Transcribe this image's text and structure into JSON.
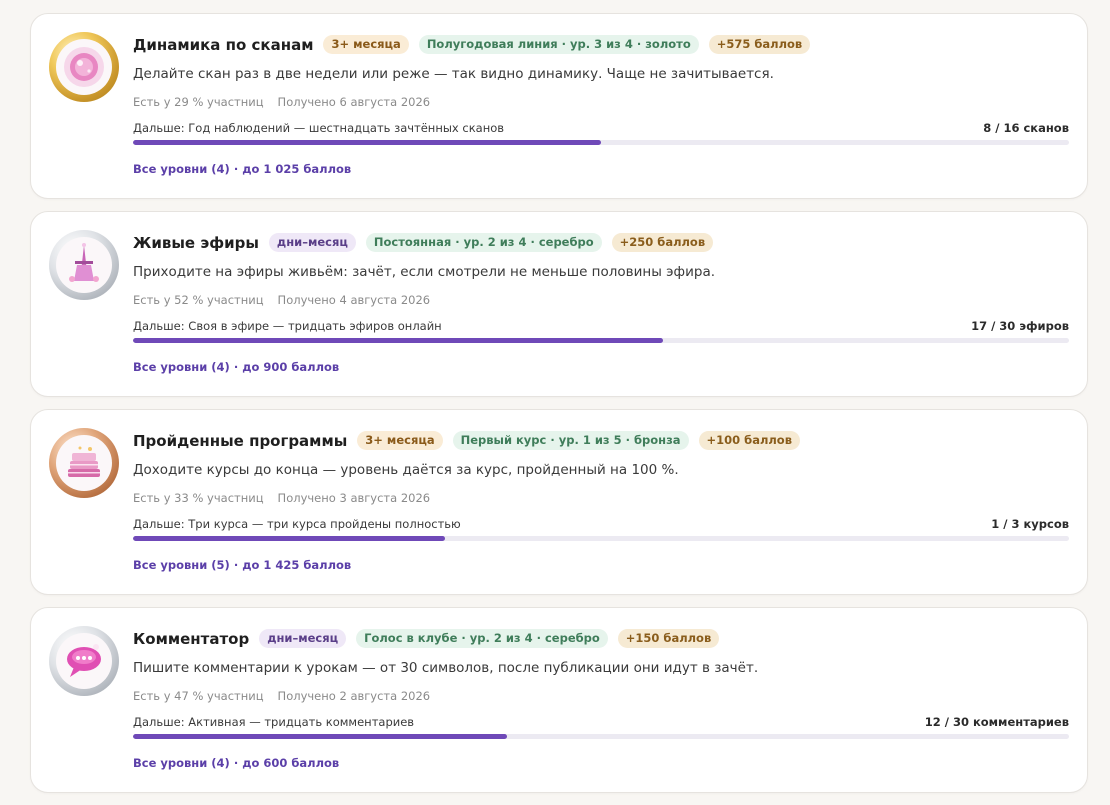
{
  "colors": {
    "accent": "#6f49b8",
    "link": "#5b3fa8",
    "page_bg": "#f8f6f3",
    "track": "#eceaf2"
  },
  "achievements": [
    {
      "title": "Динамика по сканам",
      "period": "3+ месяца",
      "line": "Полугодовая линия · ур. 3 из 4 · золото",
      "points": "+575 баллов",
      "description": "Делайте скан раз в две недели или реже — так видно динамику. Чаще не зачитывается.",
      "share": "Есть у 29 % участниц",
      "received": "Получено 6 августа 2026",
      "next": "Дальше: Год наблюдений — шестнадцать зачтённых сканов",
      "count": "8 / 16 сканов",
      "progress": 0.5,
      "levels_link": "Все уровни (4) · до 1 025 баллов",
      "medal": "gold",
      "icon": "crystal-icon"
    },
    {
      "title": "Живые эфиры",
      "period": "дни–месяц",
      "line": "Постоянная · ур. 2 из 4 · серебро",
      "points": "+250 баллов",
      "description": "Приходите на эфиры живьём: зачёт, если смотрели не меньше половины эфира.",
      "share": "Есть у 52 % участниц",
      "received": "Получено 4 августа 2026",
      "next": "Дальше: Своя в эфире — тридцать эфиров онлайн",
      "count": "17 / 30 эфиров",
      "progress": 0.5667,
      "levels_link": "Все уровни (4) · до 900 баллов",
      "medal": "silver",
      "icon": "tower-icon"
    },
    {
      "title": "Пройденные программы",
      "period": "3+ месяца",
      "line": "Первый курс · ур. 1 из 5 · бронза",
      "points": "+100 баллов",
      "description": "Доходите курсы до конца — уровень даётся за курс, пройденный на 100 %.",
      "share": "Есть у 33 % участниц",
      "received": "Получено 3 августа 2026",
      "next": "Дальше: Три курса — три курса пройдены полностью",
      "count": "1 / 3 курсов",
      "progress": 0.3333,
      "levels_link": "Все уровни (5) · до 1 425 баллов",
      "medal": "bronze",
      "icon": "books-icon"
    },
    {
      "title": "Комментатор",
      "period": "дни–месяц",
      "line": "Голос в клубе · ур. 2 из 4 · серебро",
      "points": "+150 баллов",
      "description": "Пишите комментарии к урокам — от 30 символов, после публикации они идут в зачёт.",
      "share": "Есть у 47 % участниц",
      "received": "Получено 2 августа 2026",
      "next": "Дальше: Активная — тридцать комментариев",
      "count": "12 / 30 комментариев",
      "progress": 0.4,
      "levels_link": "Все уровни (4) · до 600 баллов",
      "medal": "silver",
      "icon": "speech-bubble-icon"
    }
  ]
}
